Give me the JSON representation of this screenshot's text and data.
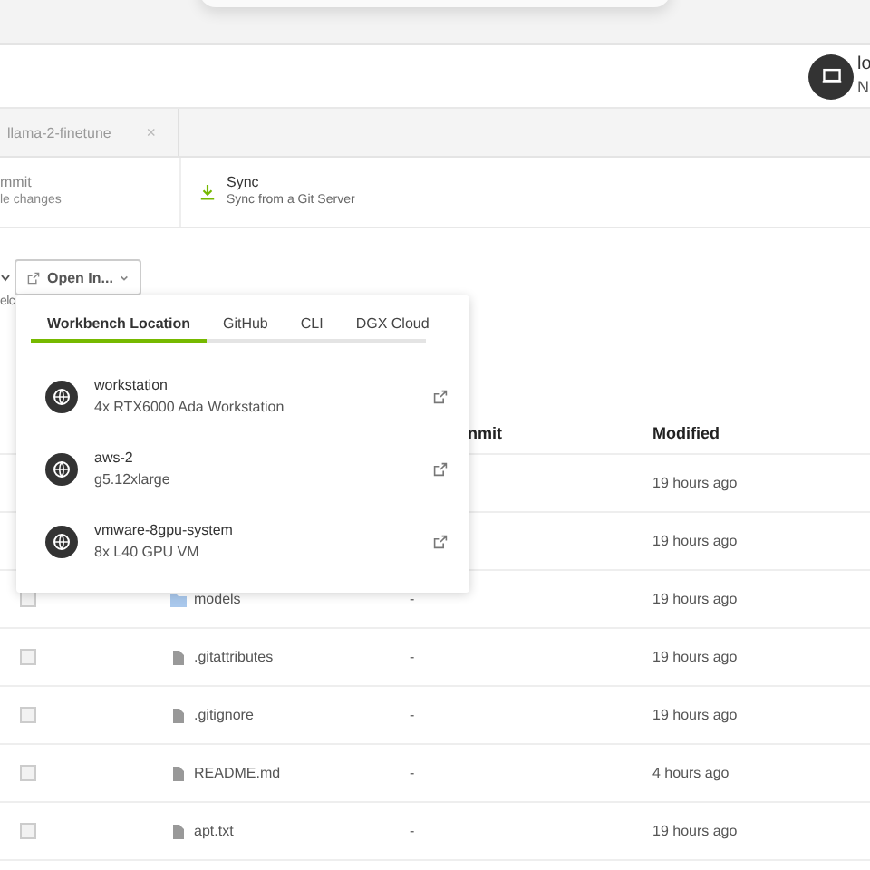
{
  "header": {
    "user_name": "lo",
    "user_org": "N"
  },
  "tabs": [
    {
      "label": "llama-2-finetune",
      "selected": false,
      "close": "×"
    }
  ],
  "actions": [
    {
      "kind": "plain",
      "title": "mmit",
      "subtitle": "le changes"
    },
    {
      "kind": "sync",
      "title": "Sync",
      "subtitle": "Sync from a Git Server"
    }
  ],
  "toolbar": {
    "open_button": "Open In...",
    "cut_label": "elc"
  },
  "open_in_menu": {
    "tabs": [
      {
        "label": "Workbench Location",
        "selected": true
      },
      {
        "label": "GitHub",
        "selected": false
      },
      {
        "label": "CLI",
        "selected": false
      },
      {
        "label": "DGX Cloud",
        "selected": false
      }
    ],
    "locations": [
      {
        "name": "workstation",
        "detail": "4x RTX6000 Ada Workstation"
      },
      {
        "name": "aws-2",
        "detail": "g5.12xlarge"
      },
      {
        "name": "vmware-8gpu-system",
        "detail": "8x L40 GPU VM"
      }
    ]
  },
  "table": {
    "columns": [
      "nmit",
      "Modified"
    ],
    "rows": [
      {
        "kind": "hidden",
        "modified": "19 hours ago"
      },
      {
        "kind": "hidden",
        "modified": "19 hours ago"
      },
      {
        "kind": "folder",
        "checked": false,
        "name": "models",
        "commit": "-",
        "modified": "19 hours ago"
      },
      {
        "kind": "file",
        "checked": false,
        "name": ".gitattributes",
        "commit": "-",
        "modified": "19 hours ago"
      },
      {
        "kind": "file",
        "checked": false,
        "name": ".gitignore",
        "commit": "-",
        "modified": "19 hours ago"
      },
      {
        "kind": "file",
        "checked": false,
        "name": "README.md",
        "commit": "-",
        "modified": "4 hours ago"
      },
      {
        "kind": "file",
        "checked": false,
        "name": "apt.txt",
        "commit": "-",
        "modified": "19 hours ago"
      }
    ]
  }
}
